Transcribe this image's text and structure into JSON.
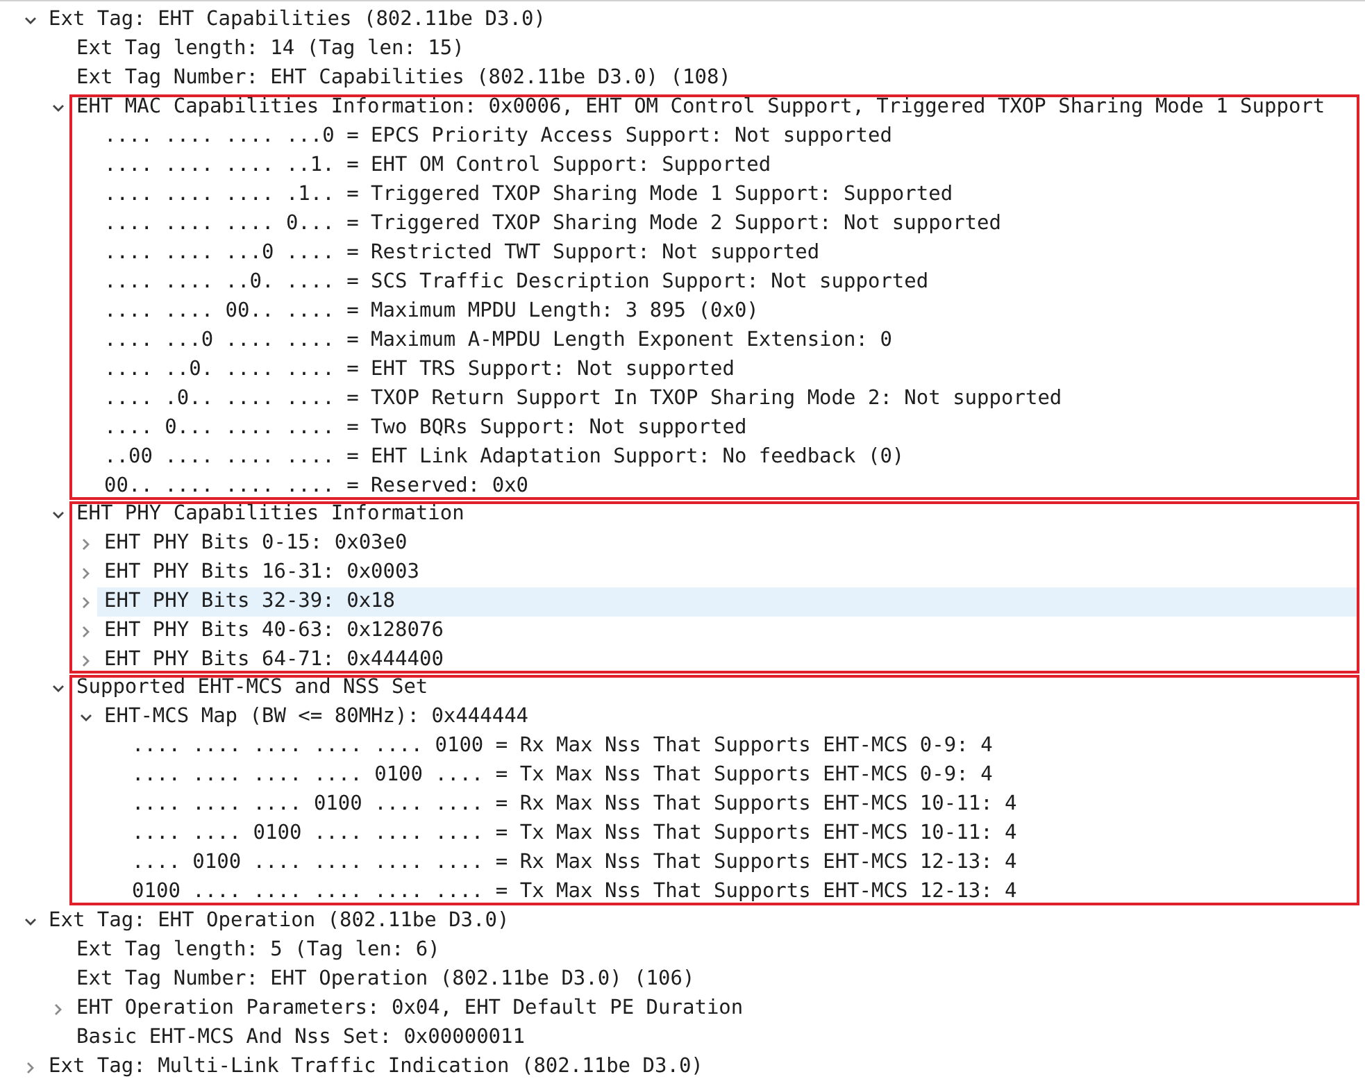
{
  "tree": [
    {
      "text": "Ext Tag: EHT Capabilities (802.11be D3.0)",
      "expanded": true,
      "selected": false,
      "children": [
        {
          "text": "Ext Tag length: 14 (Tag len: 15)",
          "selected": false,
          "boxed": false
        },
        {
          "text": "Ext Tag Number: EHT Capabilities (802.11be D3.0) (108)",
          "selected": false,
          "boxed": false
        },
        {
          "text": "EHT MAC Capabilities Information: 0x0006, EHT OM Control Support, Triggered TXOP Sharing Mode 1 Support",
          "expanded": true,
          "selected": false,
          "boxed": true,
          "children": [
            {
              "text": ".... .... .... ...0 = EPCS Priority Access Support: Not supported",
              "selected": false
            },
            {
              "text": ".... .... .... ..1. = EHT OM Control Support: Supported",
              "selected": false
            },
            {
              "text": ".... .... .... .1.. = Triggered TXOP Sharing Mode 1 Support: Supported",
              "selected": false
            },
            {
              "text": ".... .... .... 0... = Triggered TXOP Sharing Mode 2 Support: Not supported",
              "selected": false
            },
            {
              "text": ".... .... ...0 .... = Restricted TWT Support: Not supported",
              "selected": false
            },
            {
              "text": ".... .... ..0. .... = SCS Traffic Description Support: Not supported",
              "selected": false
            },
            {
              "text": ".... .... 00.. .... = Maximum MPDU Length: 3 895 (0x0)",
              "selected": false
            },
            {
              "text": ".... ...0 .... .... = Maximum A-MPDU Length Exponent Extension: 0",
              "selected": false
            },
            {
              "text": ".... ..0. .... .... = EHT TRS Support: Not supported",
              "selected": false
            },
            {
              "text": ".... .0.. .... .... = TXOP Return Support In TXOP Sharing Mode 2: Not supported",
              "selected": false
            },
            {
              "text": ".... 0... .... .... = Two BQRs Support: Not supported",
              "selected": false
            },
            {
              "text": "..00 .... .... .... = EHT Link Adaptation Support: No feedback (0)",
              "selected": false
            },
            {
              "text": "00.. .... .... .... = Reserved: 0x0",
              "selected": false
            }
          ]
        },
        {
          "text": "EHT PHY Capabilities Information",
          "expanded": true,
          "selected": false,
          "boxed": true,
          "children": [
            {
              "text": "EHT PHY Bits 0-15: 0x03e0",
              "expanded": false,
              "selected": false
            },
            {
              "text": "EHT PHY Bits 16-31: 0x0003",
              "expanded": false,
              "selected": false
            },
            {
              "text": "EHT PHY Bits 32-39: 0x18",
              "expanded": false,
              "selected": true
            },
            {
              "text": "EHT PHY Bits 40-63: 0x128076",
              "expanded": false,
              "selected": false
            },
            {
              "text": "EHT PHY Bits 64-71: 0x444400",
              "expanded": false,
              "selected": false
            }
          ]
        },
        {
          "text": "Supported EHT-MCS and NSS Set",
          "expanded": true,
          "selected": false,
          "boxed": true,
          "children": [
            {
              "text": "EHT-MCS Map (BW <= 80MHz): 0x444444",
              "expanded": true,
              "selected": false,
              "children": [
                {
                  "text": ".... .... .... .... .... 0100 = Rx Max Nss That Supports EHT-MCS 0-9: 4",
                  "selected": false
                },
                {
                  "text": ".... .... .... .... 0100 .... = Tx Max Nss That Supports EHT-MCS 0-9: 4",
                  "selected": false
                },
                {
                  "text": ".... .... .... 0100 .... .... = Rx Max Nss That Supports EHT-MCS 10-11: 4",
                  "selected": false
                },
                {
                  "text": ".... .... 0100 .... .... .... = Tx Max Nss That Supports EHT-MCS 10-11: 4",
                  "selected": false
                },
                {
                  "text": ".... 0100 .... .... .... .... = Rx Max Nss That Supports EHT-MCS 12-13: 4",
                  "selected": false
                },
                {
                  "text": "0100 .... .... .... .... .... = Tx Max Nss That Supports EHT-MCS 12-13: 4",
                  "selected": false
                }
              ]
            }
          ]
        }
      ]
    },
    {
      "text": "Ext Tag: EHT Operation (802.11be D3.0)",
      "expanded": true,
      "selected": false,
      "children": [
        {
          "text": "Ext Tag length: 5 (Tag len: 6)",
          "selected": false
        },
        {
          "text": "Ext Tag Number: EHT Operation (802.11be D3.0) (106)",
          "selected": false
        },
        {
          "text": "EHT Operation Parameters: 0x04, EHT Default PE Duration",
          "expanded": false,
          "selected": false
        },
        {
          "text": "Basic EHT-MCS And Nss Set: 0x00000011",
          "selected": false
        }
      ]
    },
    {
      "text": "Ext Tag: Multi-Link Traffic Indication (802.11be D3.0)",
      "expanded": false,
      "selected": false
    }
  ]
}
